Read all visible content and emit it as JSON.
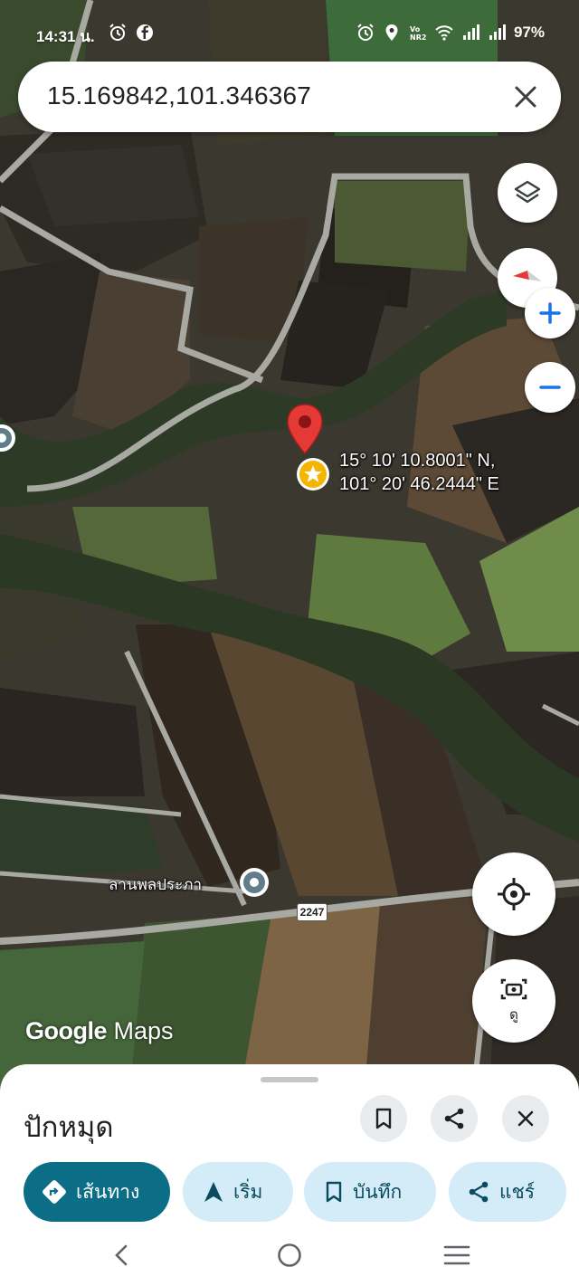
{
  "status_bar": {
    "time": "14:31 น.",
    "battery": "97%",
    "icons": [
      "alarm-icon",
      "facebook-icon",
      "alarm-icon",
      "location-icon",
      "vonr-icon",
      "wifi-icon",
      "signal-icon",
      "signal-icon"
    ]
  },
  "search": {
    "query": "15.169842,101.346367",
    "clear_icon": "close-icon"
  },
  "map": {
    "pin_coordinates_line1": "15° 10' 10.8001\" N,",
    "pin_coordinates_line2": "101° 20' 46.2444\" E",
    "place_label": "ลานพลประภา",
    "road_number": "2247",
    "logo_text_google": "Google",
    "logo_text_maps": "Maps",
    "pin_color": "#e53935",
    "star_marker_color": "#f4b400",
    "controls": [
      "layers-icon",
      "compass-icon",
      "zoom-in-icon",
      "zoom-out-icon",
      "my-location-icon",
      "camera-view-icon"
    ],
    "view_button_label": "ดู"
  },
  "sheet": {
    "title": "ปักหมุด",
    "actions": {
      "directions": "เส้นทาง",
      "start": "เริ่ม",
      "save": "บันทึก",
      "share": "แชร์"
    },
    "accent_color": "#0b6e86",
    "chip_color": "#d3ecf7"
  },
  "nav_bar": {
    "icons": [
      "back-icon",
      "home-icon",
      "recents-icon"
    ]
  }
}
